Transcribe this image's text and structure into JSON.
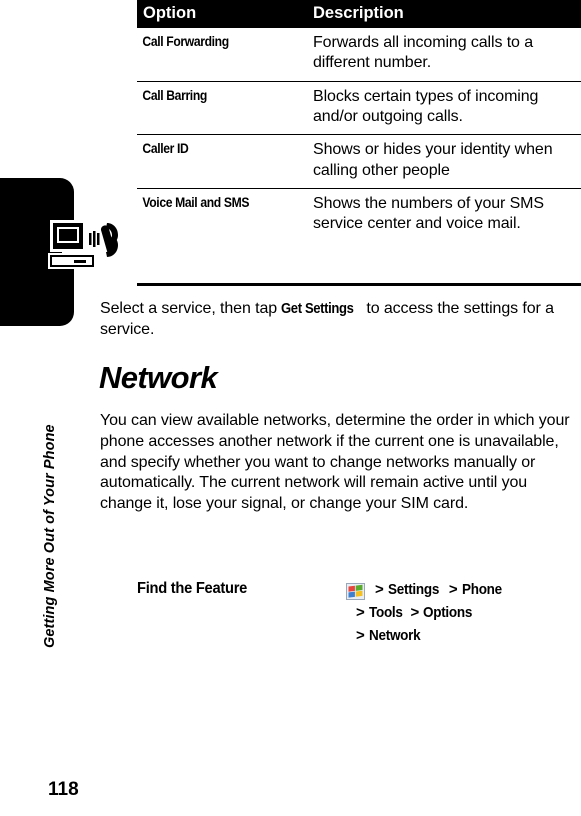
{
  "page": {
    "number": "118",
    "running_head": "Getting More Out of Your Phone",
    "chapter_icon": "computer-phone-icon"
  },
  "table": {
    "headers": {
      "option": "Option",
      "description": "Description"
    },
    "rows": [
      {
        "option": "Call Forwarding",
        "description": "Forwards all incoming calls to a different number."
      },
      {
        "option": "Call Barring",
        "description": "Blocks certain types of incoming and/or outgoing calls."
      },
      {
        "option": "Caller ID",
        "description": "Shows or hides your identity when calling other people"
      },
      {
        "option": "Voice Mail and SMS",
        "description": "Shows the numbers of your SMS service center and voice mail."
      }
    ]
  },
  "intro": {
    "before": "Select a service, then tap ",
    "ui_term": "Get Settings",
    "after": " to access the settings for a service."
  },
  "section": {
    "heading": "Network",
    "paragraph": "You can view available networks, determine the order in which your phone accesses another network if the current one is unavailable, and specify whether you want to change networks manually or automatically. The current network will remain active until you change it, lose your signal, or change your SIM card."
  },
  "find_feature": {
    "label": "Find the Feature",
    "icon": "windows-start-icon",
    "lines": [
      {
        "indent": false,
        "items": [
          "Settings",
          "Phone"
        ]
      },
      {
        "indent": true,
        "items": [
          "Tools",
          "Options"
        ]
      },
      {
        "indent": true,
        "items": [
          "Network"
        ]
      }
    ],
    "separator": ">"
  },
  "colors": {
    "text": "#000000",
    "header_bg": "#000000",
    "header_text": "#ffffff",
    "page_bg": "#ffffff",
    "win_red": "#e8453c",
    "win_green": "#58ab2d",
    "win_blue": "#3f7fd0",
    "win_yellow": "#f4c022"
  }
}
